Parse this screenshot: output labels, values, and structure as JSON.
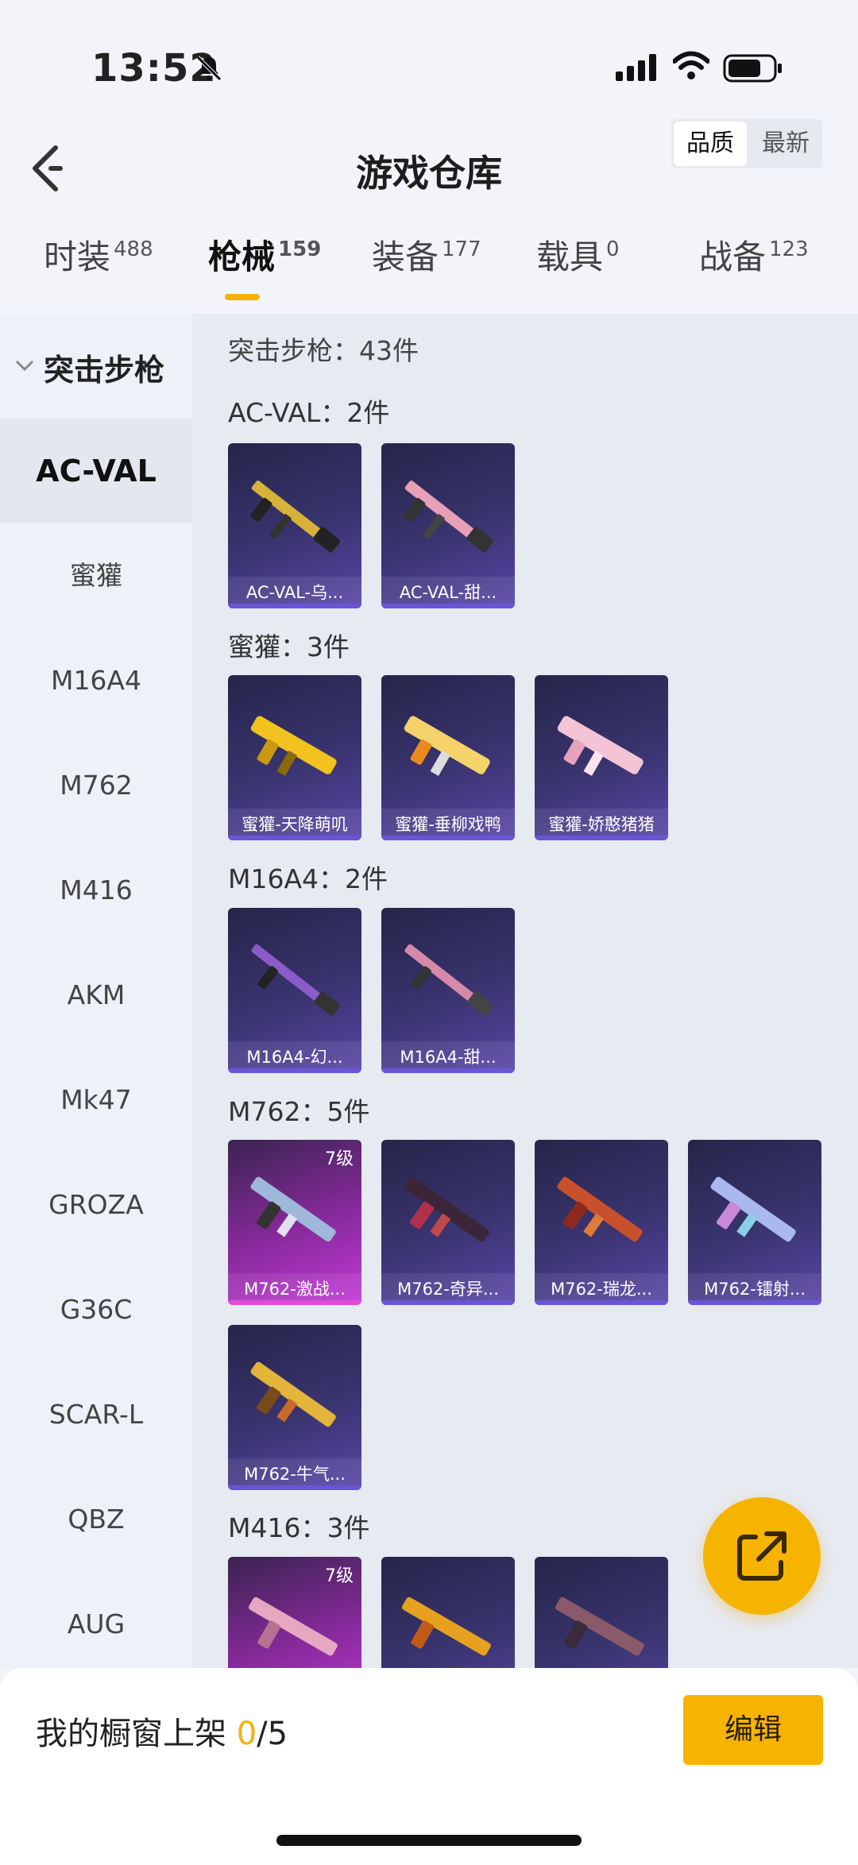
{
  "status_bar": {
    "time": "13:52"
  },
  "header": {
    "title": "游戏仓库",
    "sort": {
      "quality": "品质",
      "newest": "最新"
    }
  },
  "tabs": [
    {
      "label": "时装",
      "count": "488"
    },
    {
      "label": "枪械",
      "count": "159"
    },
    {
      "label": "装备",
      "count": "177"
    },
    {
      "label": "载具",
      "count": "0"
    },
    {
      "label": "战备",
      "count": "123"
    }
  ],
  "sidebar": {
    "category": "突击步枪",
    "items": [
      "AC-VAL",
      "蜜獾",
      "M16A4",
      "M762",
      "M416",
      "AKM",
      "Mk47",
      "GROZA",
      "G36C",
      "SCAR-L",
      "QBZ",
      "AUG"
    ]
  },
  "content": {
    "total": "突击步枪：43件",
    "sections": [
      {
        "title": "AC-VAL：2件",
        "items": [
          {
            "name": "AC-VAL-乌..."
          },
          {
            "name": "AC-VAL-甜..."
          }
        ]
      },
      {
        "title": "蜜獾：3件",
        "items": [
          {
            "name": "蜜獾-天降萌叽"
          },
          {
            "name": "蜜獾-垂柳戏鸭"
          },
          {
            "name": "蜜獾-娇憨猪猪"
          }
        ]
      },
      {
        "title": "M16A4：2件",
        "items": [
          {
            "name": "M16A4-幻..."
          },
          {
            "name": "M16A4-甜..."
          }
        ]
      },
      {
        "title": "M762：5件",
        "items": [
          {
            "name": "M762-激战...",
            "level": "7级"
          },
          {
            "name": "M762-奇异..."
          },
          {
            "name": "M762-瑞龙..."
          },
          {
            "name": "M762-镭射..."
          },
          {
            "name": "M762-牛气..."
          }
        ]
      },
      {
        "title": "M416：3件",
        "items": [
          {
            "name": "",
            "level": "7级"
          },
          {
            "name": ""
          },
          {
            "name": ""
          }
        ]
      }
    ]
  },
  "showcase": {
    "label": "我的橱窗上架 ",
    "count": "0",
    "max": "/5",
    "edit_label": "编辑"
  },
  "colors": {
    "accent": "#f6b400",
    "card_blue": "#3a3470",
    "card_purple": "#8a2a9e"
  },
  "icons": [
    "bell-slash-icon",
    "signal-icon",
    "wifi-icon",
    "battery-icon",
    "back-icon",
    "chevron-down-icon",
    "share-icon"
  ]
}
